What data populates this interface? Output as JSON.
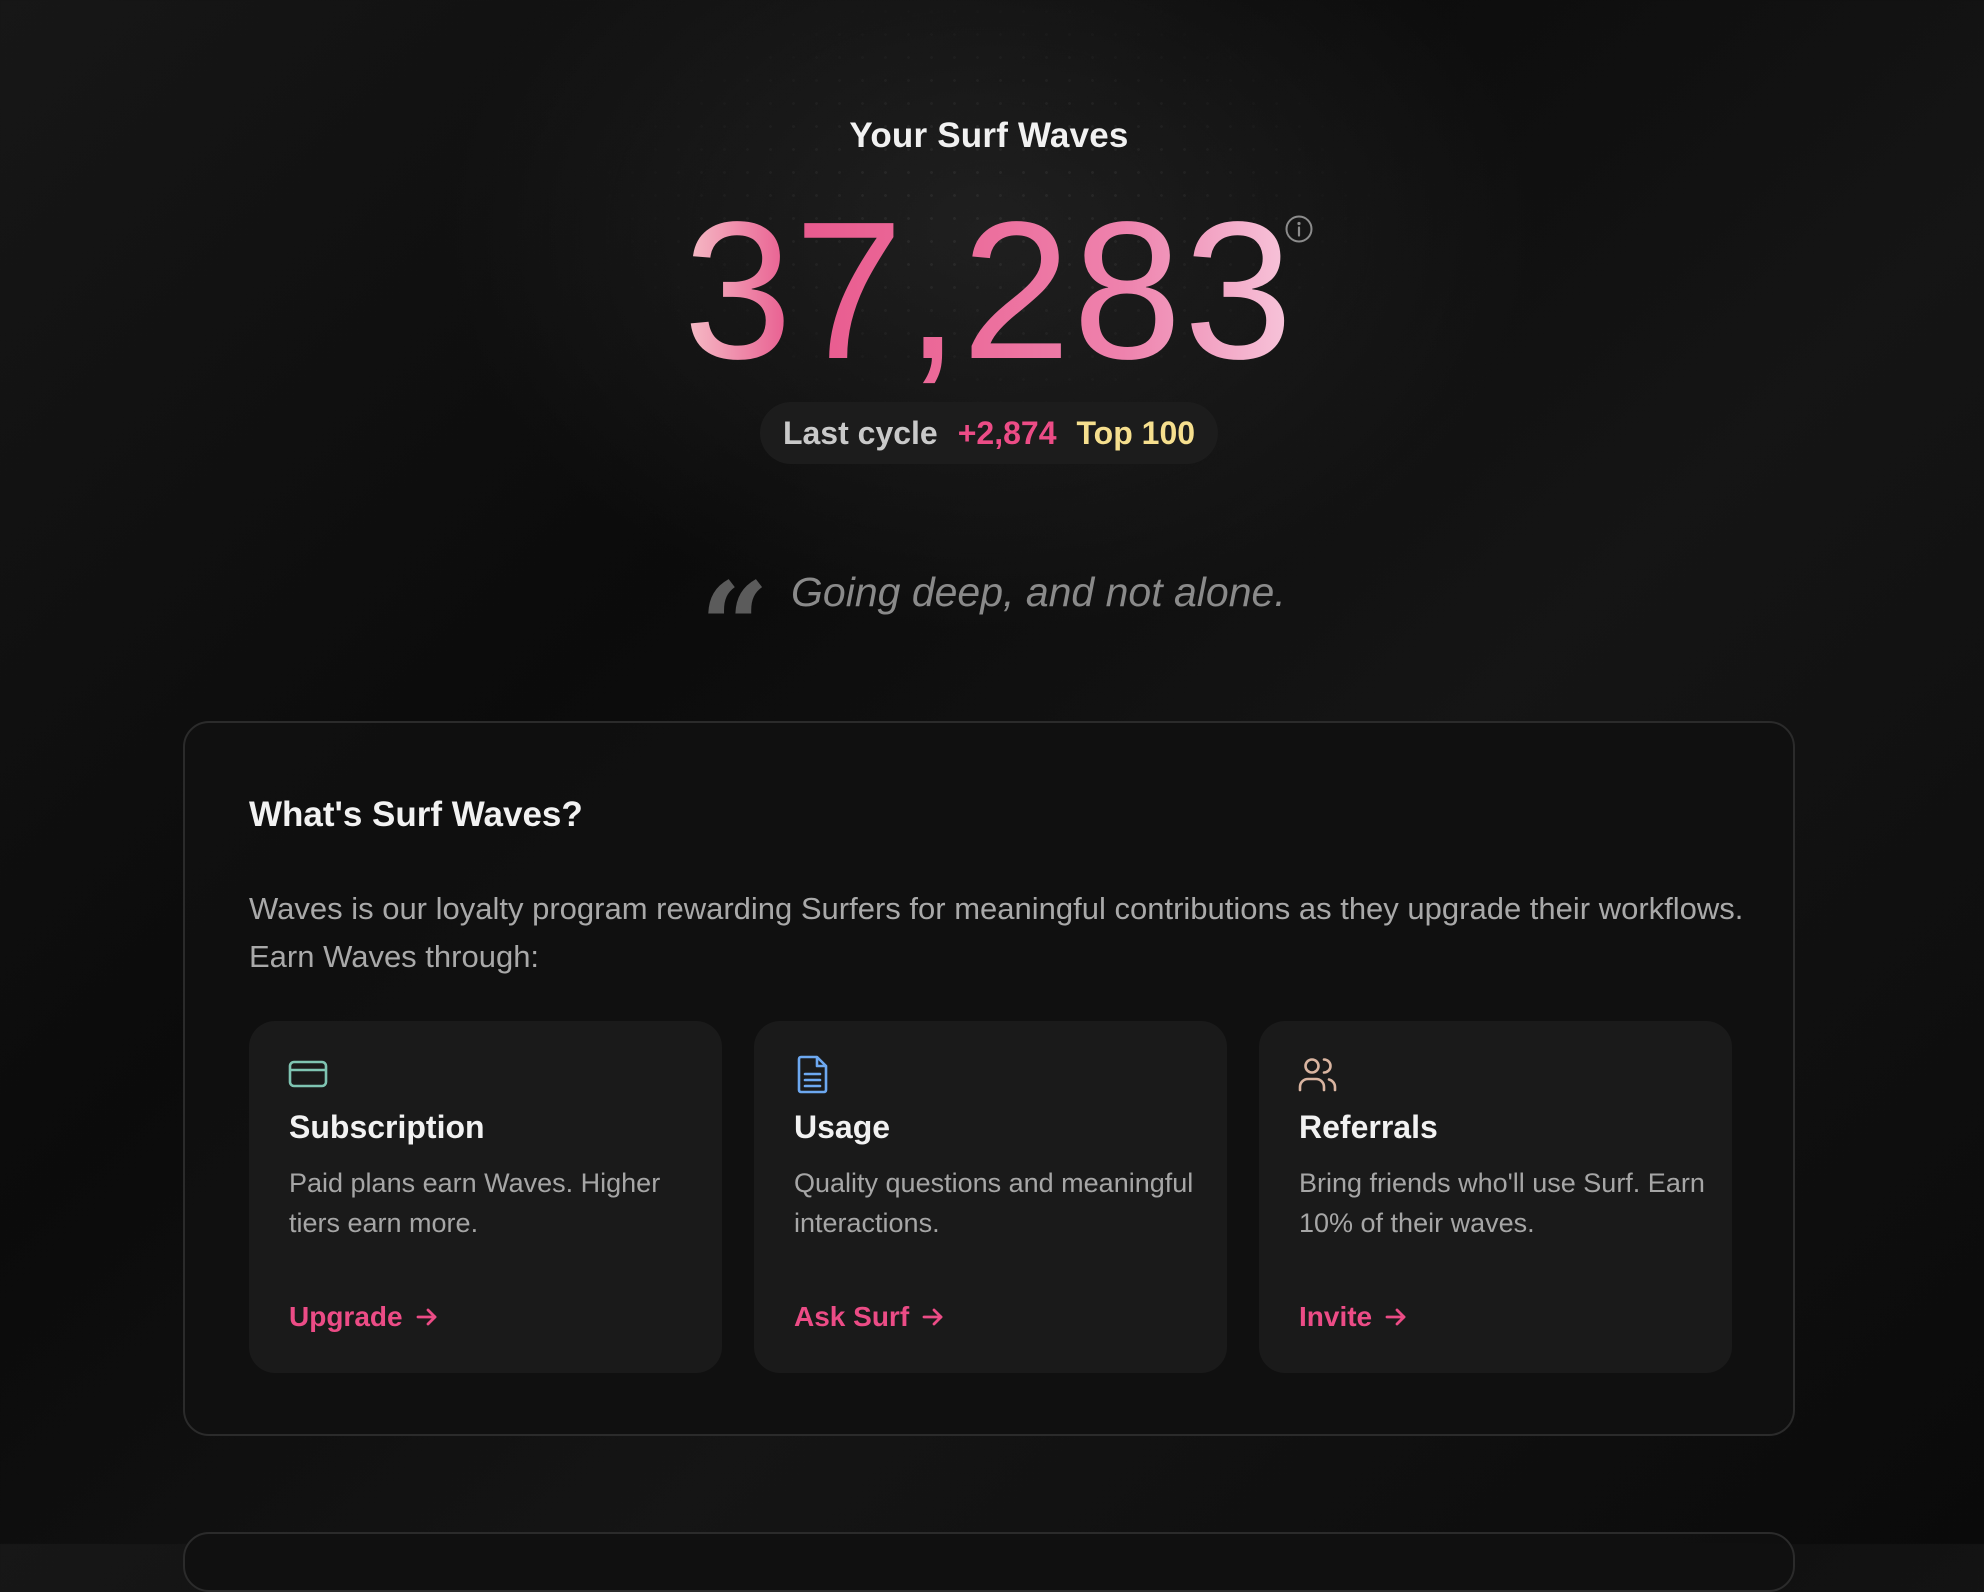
{
  "hero": {
    "title": "Your Surf Waves",
    "score": "37,283",
    "info_icon": "info-icon",
    "stats": {
      "label": "Last cycle",
      "delta": "+2,874",
      "rank": "Top 100"
    }
  },
  "quote": {
    "mark": "“",
    "text": "Going deep, and not alone."
  },
  "about": {
    "title": "What's Surf Waves?",
    "description": "Waves is our loyalty program rewarding Surfers for meaningful contributions as they upgrade their workflows. Earn Waves through:",
    "features": [
      {
        "icon": "credit-card-icon",
        "icon_color": "#7fc4b2",
        "title": "Subscription",
        "description": "Paid plans earn Waves. Higher tiers earn more.",
        "link": "Upgrade"
      },
      {
        "icon": "document-icon",
        "icon_color": "#6da8f0",
        "title": "Usage",
        "description": "Quality questions and meaningful interactions.",
        "link": "Ask Surf"
      },
      {
        "icon": "users-icon",
        "icon_color": "#d9b4a0",
        "title": "Referrals",
        "description": "Bring friends who'll use Surf. Earn 10% of their waves.",
        "link": "Invite"
      }
    ]
  },
  "colors": {
    "accent_pink": "#ec4c86",
    "rank_gold": "#f6df8e",
    "background": "#111111"
  }
}
